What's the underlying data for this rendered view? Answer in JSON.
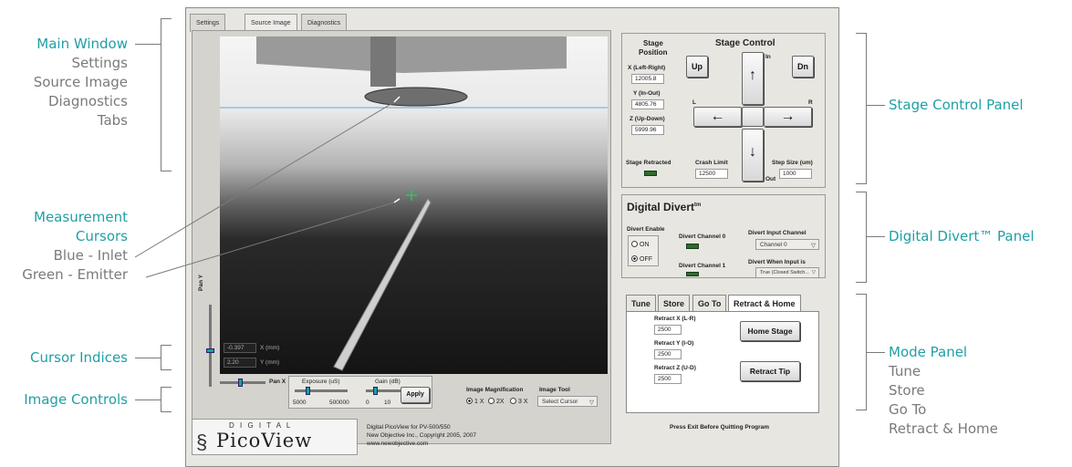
{
  "annotations": {
    "main_window": {
      "title": "Main Window",
      "items": [
        "Settings",
        "Source Image",
        "Diagnostics",
        "Tabs"
      ]
    },
    "measurement_cursors": {
      "title": "Measurement",
      "title2": "Cursors",
      "items": [
        "Blue - Inlet",
        "Green - Emitter"
      ]
    },
    "cursor_indices": "Cursor Indices",
    "image_controls": "Image Controls",
    "stage_control_panel": "Stage Control Panel",
    "digital_divert_panel": "Digital Divert™ Panel",
    "mode_panel": {
      "title": "Mode Panel",
      "items": [
        "Tune",
        "Store",
        "Go To",
        "Retract & Home"
      ]
    }
  },
  "tabs": [
    "Settings",
    "Source Image",
    "Diagnostics"
  ],
  "image_panel": {
    "pan_y": "Pan Y",
    "pan_x": "Pan X",
    "cursor_x_value": "-0.397",
    "cursor_x_unit": "X (mm)",
    "cursor_y_value": "2.20",
    "cursor_y_unit": "Y (mm)",
    "exposure_label": "Exposure (uS)",
    "exposure_min": "5000",
    "exposure_max": "500000",
    "gain_label": "Gain (dB)",
    "gain_ticks": [
      "0",
      "10",
      "20"
    ],
    "apply": "Apply",
    "magnification_label": "Image Magnification",
    "magnification_options": [
      "1 X",
      "2X",
      "3 X"
    ],
    "tool_label": "Image Tool",
    "tool_value": "Select Cursor"
  },
  "stage": {
    "position_label1": "Stage",
    "position_label2": "Position",
    "title": "Stage Control",
    "x_label": "X (Left-Right)",
    "x_value": "12005.8",
    "y_label": "Y (In-Out)",
    "y_value": "4805.76",
    "z_label": "Z (Up-Down)",
    "z_value": "5999.96",
    "up": "Up",
    "dn": "Dn",
    "in": "In",
    "out": "Out",
    "l": "L",
    "r": "R",
    "retracted": "Stage Retracted",
    "crash_label": "Crash Limit",
    "crash_value": "12500",
    "step_label": "Step Size (um)",
    "step_value": "1000"
  },
  "divert": {
    "title": "Digital Divert",
    "tm": "tm",
    "enable_label": "Divert Enable",
    "on": "ON",
    "off": "OFF",
    "ch0": "Divert Channel 0",
    "ch1": "Divert Channel 1",
    "input_label": "Divert Input Channel",
    "input_value": "Channel 0",
    "when_label": "Divert When Input is",
    "when_value": "True (Closed Switch..."
  },
  "mode": {
    "tabs": [
      "Tune",
      "Store",
      "Go To",
      "Retract & Home"
    ],
    "rx_label": "Retract X (L-R)",
    "rx_value": "2500",
    "ry_label": "Retract Y (I-O)",
    "ry_value": "2500",
    "rz_label": "Retract Z (U-D)",
    "rz_value": "2500",
    "home": "Home Stage",
    "retract": "Retract Tip"
  },
  "footer": {
    "logo_top": "D I G I T A L",
    "logo_main": "PicoView",
    "info1": "Digital PicoView for PV-500/550",
    "info2": "New Objective Inc., Copyright 2005, 2007",
    "info3": "www.newobjective.com",
    "exit_note": "Press Exit Before Quitting Program"
  },
  "colors": {
    "accent": "#1f9fa6",
    "annotation_gray": "#7a7a7a",
    "led_green": "#2f6b2f"
  }
}
